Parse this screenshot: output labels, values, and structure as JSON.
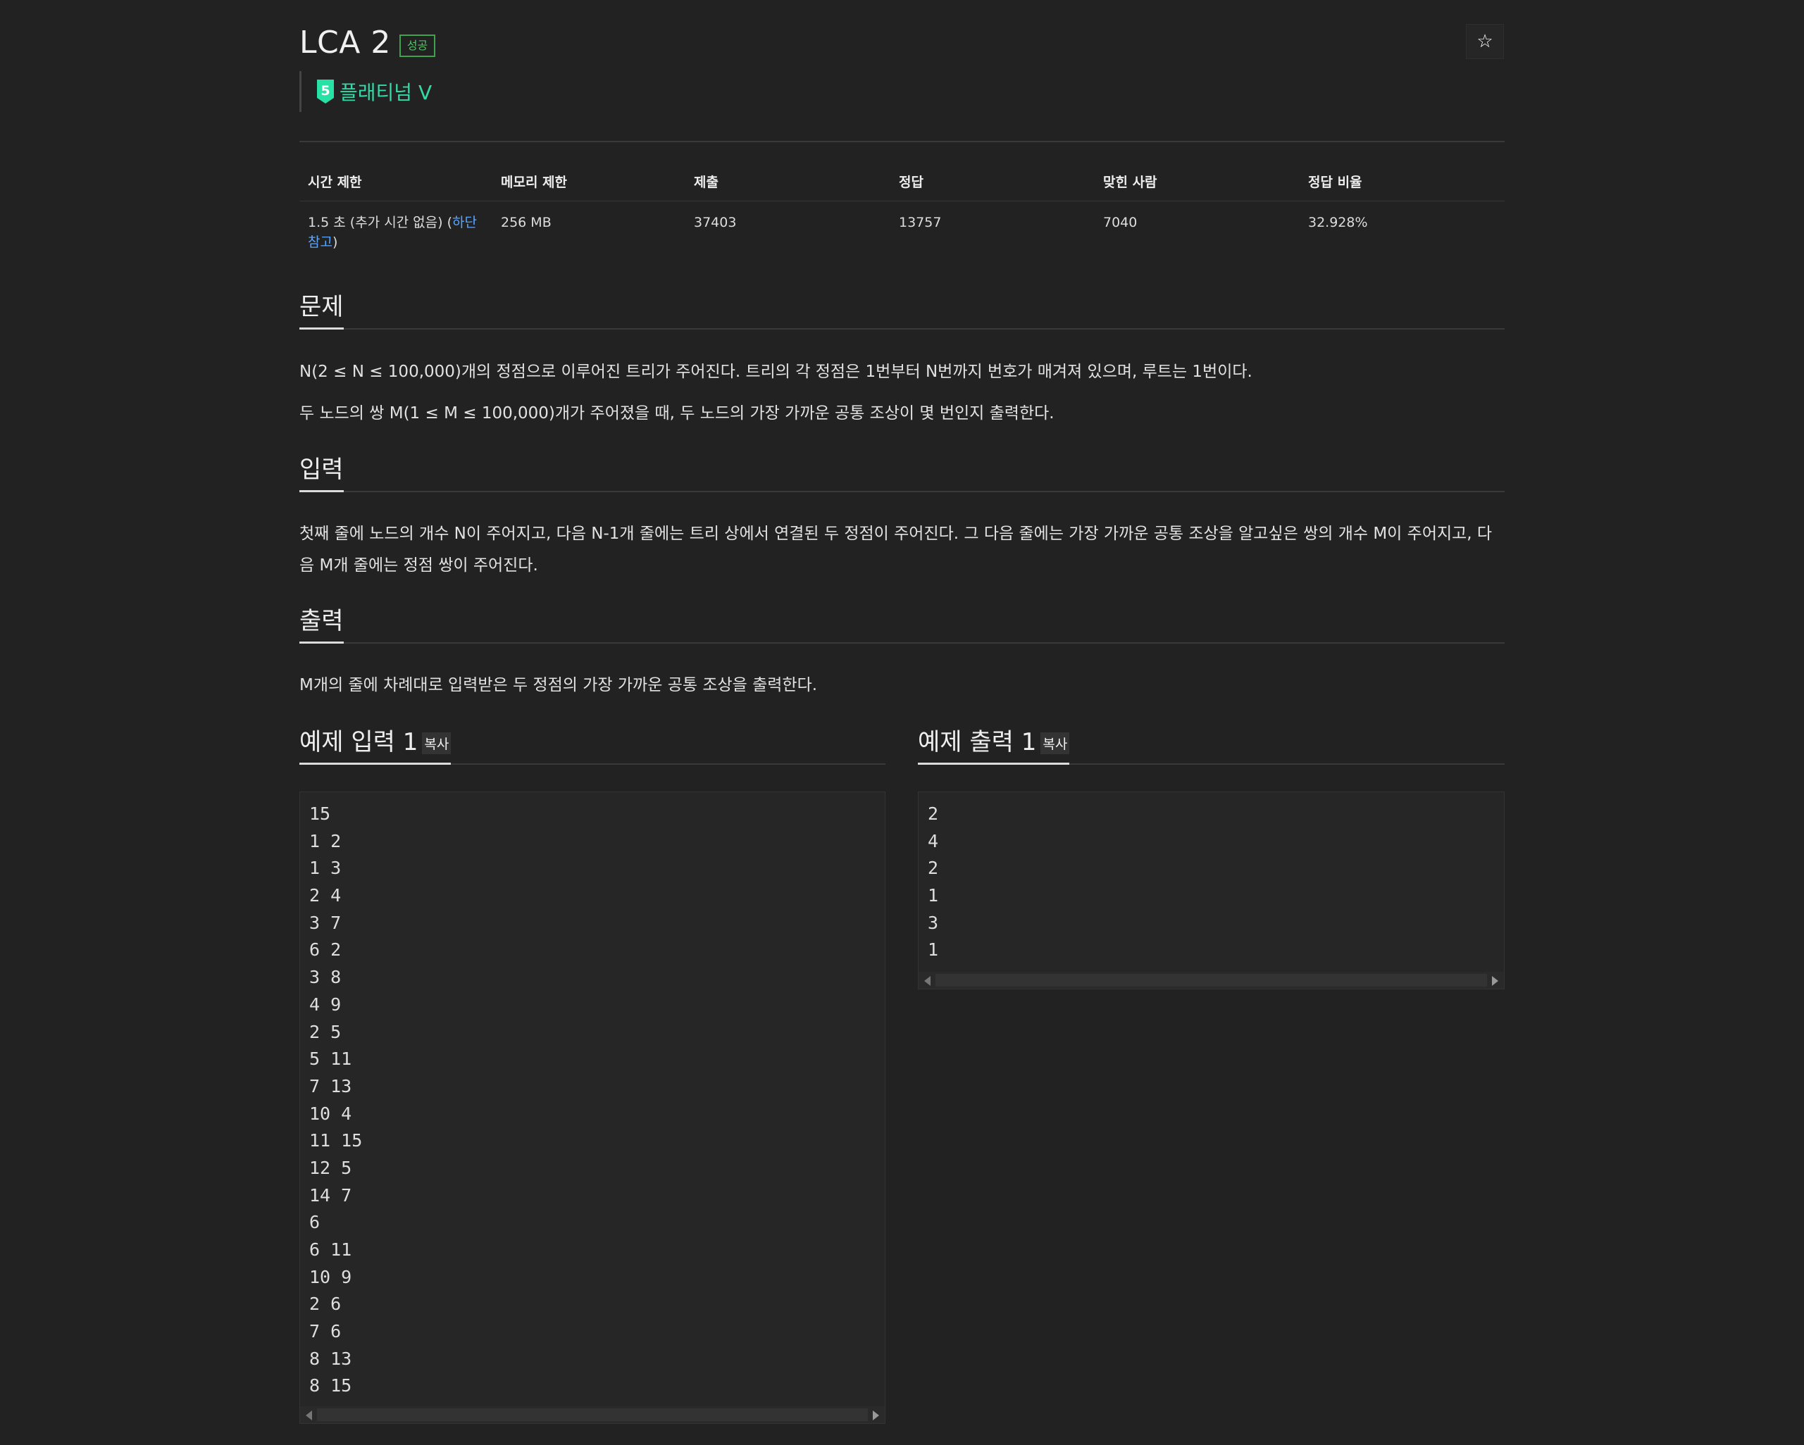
{
  "problem": {
    "title": "LCA 2",
    "status_badge": "성공",
    "tier_label": "플래티넘 V",
    "tier_number": "5",
    "tier_color": "#35d8a6"
  },
  "info_table": {
    "headers": [
      "시간 제한",
      "메모리 제한",
      "제출",
      "정답",
      "맞힌 사람",
      "정답 비율"
    ],
    "time_limit_prefix": "1.5 초 (추가 시간 없음) (",
    "time_limit_link": "하단 참고",
    "time_limit_suffix": ")",
    "memory_limit": "256 MB",
    "submissions": "37403",
    "accepted": "13757",
    "solvers": "7040",
    "ratio": "32.928%"
  },
  "sections": {
    "problem_title": "문제",
    "problem_p1": "N(2 ≤ N ≤ 100,000)개의 정점으로 이루어진 트리가 주어진다. 트리의 각 정점은 1번부터 N번까지 번호가 매겨져 있으며, 루트는 1번이다.",
    "problem_p2": "두 노드의 쌍 M(1 ≤ M ≤ 100,000)개가 주어졌을 때, 두 노드의 가장 가까운 공통 조상이 몇 번인지 출력한다.",
    "input_title": "입력",
    "input_p1": "첫째 줄에 노드의 개수 N이 주어지고, 다음 N-1개 줄에는 트리 상에서 연결된 두 정점이 주어진다. 그 다음 줄에는 가장 가까운 공통 조상을 알고싶은 쌍의 개수 M이 주어지고, 다음 M개 줄에는 정점 쌍이 주어진다.",
    "output_title": "출력",
    "output_p1": "M개의 줄에 차례대로 입력받은 두 정점의 가장 가까운 공통 조상을 출력한다."
  },
  "samples": {
    "input_title": "예제 입력 1",
    "output_title": "예제 출력 1",
    "copy_label": "복사",
    "input_lines": [
      "15",
      "1 2",
      "1 3",
      "2 4",
      "3 7",
      "6 2",
      "3 8",
      "4 9",
      "2 5",
      "5 11",
      "7 13",
      "10 4",
      "11 15",
      "12 5",
      "14 7",
      "6",
      "6 11",
      "10 9",
      "2 6",
      "7 6",
      "8 13",
      "8 15"
    ],
    "output_lines": [
      "2",
      "4",
      "2",
      "1",
      "3",
      "1"
    ]
  }
}
